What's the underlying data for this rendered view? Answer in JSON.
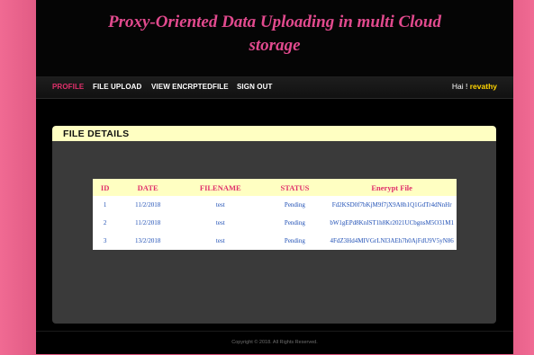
{
  "header": {
    "title": "Proxy-Oriented Data Uploading in multi Cloud storage"
  },
  "nav": {
    "items": [
      {
        "label": "PROFILE",
        "active": true
      },
      {
        "label": "FILE UPLOAD",
        "active": false
      },
      {
        "label": "VIEW ENCRPTEDFILE",
        "active": false
      },
      {
        "label": "SIGN OUT",
        "active": false
      }
    ],
    "greeting_prefix": "Hai ! ",
    "username": "revathy"
  },
  "panel": {
    "title": "FILE DETAILS",
    "table": {
      "columns": [
        "ID",
        "DATE",
        "FILENAME",
        "STATUS",
        "Enerypt File"
      ],
      "rows": [
        [
          "1",
          "11/2/2018",
          "test",
          "Pending",
          "Fd2KSD0f7bKjM9f7jX9A8h1Q1GdTr4dNnHr"
        ],
        [
          "2",
          "11/2/2018",
          "test",
          "Pending",
          "bW1gEPd8KnIST1h8Kr2021UCbgnsM5O31M1"
        ],
        [
          "3",
          "13/2/2018",
          "test",
          "Pending",
          "4FdZ3Hd4MIVGrLNI3AEh7h0AjFdU9V5yN86"
        ]
      ]
    }
  },
  "footer": {
    "text": "Copyright © 2018. All Rights Reserved."
  },
  "colors": {
    "accent_pink": "#e0306b",
    "title_pink": "#e24a8e",
    "highlight_yellow": "#ffd400",
    "table_header_bg": "#ffffc2",
    "link_blue": "#1f4fb5"
  }
}
